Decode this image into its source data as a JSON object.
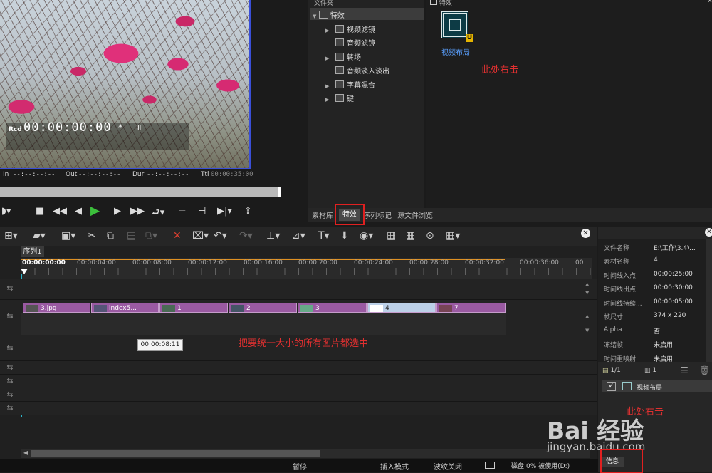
{
  "preview": {
    "timecode_label": "Rcd",
    "timecode": "00:00:00:00",
    "timecode_suffix": "*",
    "pause_glyph": "II",
    "in_label": "In",
    "in_value": "--:--:--:--",
    "out_label": "Out",
    "out_value": "--:--:--:--",
    "dur_label": "Dur",
    "dur_value": "--:--:--:--",
    "ttl_label": "Ttl",
    "ttl_value": "00:00:35:00"
  },
  "effects": {
    "header": "文件夹",
    "root": "特效",
    "items": [
      {
        "label": "视频滤镜",
        "expandable": true
      },
      {
        "label": "音频滤镜",
        "expandable": false
      },
      {
        "label": "转场",
        "expandable": true
      },
      {
        "label": "音频淡入淡出",
        "expandable": false
      },
      {
        "label": "字幕混合",
        "expandable": true
      },
      {
        "label": "键",
        "expandable": true
      }
    ],
    "right_header": "特效",
    "tile_label": "视频布局",
    "note_right_click": "此处右击"
  },
  "tabs": [
    "素材库",
    "特效",
    "序列标记",
    "源文件浏览"
  ],
  "timeline": {
    "sequence": "序列1",
    "ruler": [
      "00:00:00:00",
      "00:00:04:00",
      "00:00:08:00",
      "00:00:12:00",
      "00:00:16:00",
      "00:00:20:00",
      "00:00:24:00",
      "00:00:28:00",
      "00:00:32:00",
      "00:00:36:00",
      "00"
    ],
    "clips": [
      "3.jpg",
      "index5...",
      "1",
      "2",
      "3",
      "4",
      "7"
    ],
    "tooltip": "00:00:08:11",
    "note_select": "把要统一大小的所有图片都选中"
  },
  "info": {
    "rows": [
      {
        "k": "文件名称",
        "v": "E:\\工作\\3.4\\..."
      },
      {
        "k": "素材名称",
        "v": "4"
      },
      {
        "k": "时间线入点",
        "v": "00:00:25:00"
      },
      {
        "k": "时间线出点",
        "v": "00:00:30:00"
      },
      {
        "k": "时间线持续...",
        "v": "00:00:05:00"
      },
      {
        "k": "帧尺寸",
        "v": "374 x 220"
      },
      {
        "k": "Alpha",
        "v": "否"
      },
      {
        "k": "冻结帧",
        "v": "未启用"
      },
      {
        "k": "时间重映射",
        "v": "未启用"
      }
    ],
    "page": "1/1",
    "count": "1",
    "applied": "视频布局",
    "tab": "信息",
    "note_right_click": "此处右击"
  },
  "status": {
    "pause": "暂停",
    "insert_mode": "插入模式",
    "ripple": "波纹关闭",
    "disk": "磁盘:0% 被使用(D:)"
  },
  "watermark": {
    "brand": "Bai 经验",
    "url": "jingyan.baidu.com"
  }
}
